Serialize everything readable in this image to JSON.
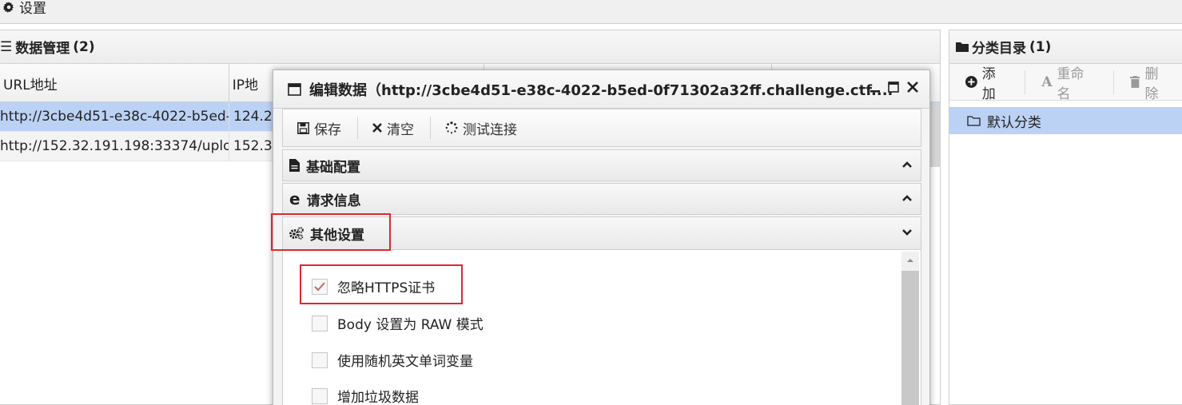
{
  "topbar": {
    "settings_label": "设置"
  },
  "data_panel": {
    "title": "数据管理",
    "count": "(2)",
    "columns": [
      "URL地址",
      "IP地"
    ],
    "rows": [
      {
        "url": "http://3cbe4d51-e38c-4022-b5ed-",
        "ip": "124.2"
      },
      {
        "url": "http://152.32.191.198:33374/uplo",
        "ip": "152.3"
      }
    ]
  },
  "category_panel": {
    "title": "分类目录",
    "count": "(1)",
    "add_label": "添加",
    "rename_label": "重命名",
    "delete_label": "删除",
    "default_category": "默认分类"
  },
  "dialog": {
    "title": "编辑数据（http://3cbe4d51-e38c-4022-b5ed-0f71302a32ff.challenge.ctf....",
    "toolbar": {
      "save": "保存",
      "clear": "清空",
      "test": "测试连接"
    },
    "sections": {
      "basic": "基础配置",
      "request": "请求信息",
      "other": "其他设置"
    },
    "options": [
      {
        "label": "忽略HTTPS证书",
        "checked": true
      },
      {
        "label": "Body 设置为 RAW 模式",
        "checked": false
      },
      {
        "label": "使用随机英文单词变量",
        "checked": false
      },
      {
        "label": "增加垃圾数据",
        "checked": false
      }
    ]
  },
  "colors": {
    "selection": "#bcd2f5",
    "highlight_box": "#e0262f"
  }
}
